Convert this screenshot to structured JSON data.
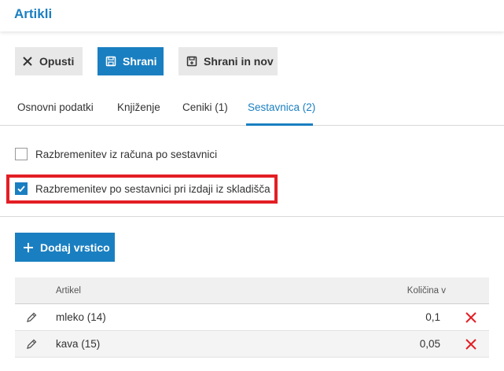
{
  "header": {
    "title": "Artikli"
  },
  "toolbar": {
    "cancel_label": "Opusti",
    "save_label": "Shrani",
    "save_new_label": "Shrani in nov"
  },
  "tabs": [
    {
      "label": "Osnovni podatki",
      "active": false
    },
    {
      "label": "Knjiženje",
      "active": false
    },
    {
      "label": "Ceniki (1)",
      "active": false
    },
    {
      "label": "Sestavnica (2)",
      "active": true
    }
  ],
  "options": [
    {
      "label": "Razbremenitev iz računa po sestavnici",
      "checked": false
    },
    {
      "label": "Razbremenitev po sestavnici pri izdaji iz skladišča",
      "checked": true
    }
  ],
  "add_row_label": "Dodaj vrstico",
  "table": {
    "columns": {
      "article": "Artikel",
      "quantity": "Količina v"
    },
    "rows": [
      {
        "article": "mleko (14)",
        "quantity": "0,1"
      },
      {
        "article": "kava (15)",
        "quantity": "0,05"
      }
    ]
  },
  "colors": {
    "accent": "#1a7fc1",
    "highlight": "#e31e24",
    "delete": "#e31e24"
  }
}
